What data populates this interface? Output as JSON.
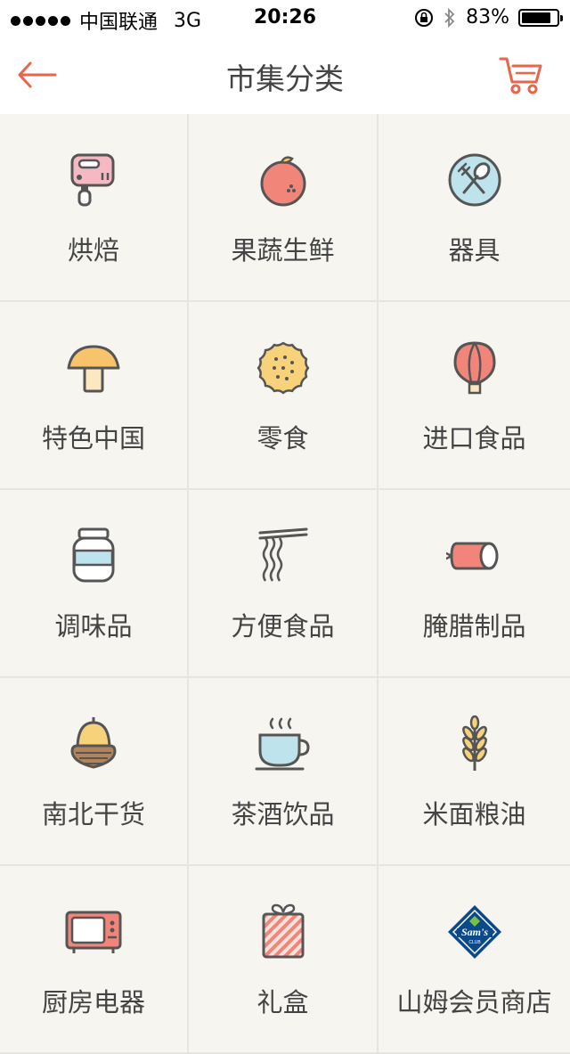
{
  "status": {
    "carrier": "中国联通",
    "network": "3G",
    "time": "20:26",
    "battery": "83%"
  },
  "nav": {
    "title": "市集分类",
    "back_icon": "back-arrow-icon",
    "cart_icon": "cart-icon"
  },
  "colors": {
    "accent": "#e8664a",
    "background": "#f6f5f0",
    "divider": "#e6e5e0"
  },
  "categories": [
    {
      "label": "烘焙",
      "icon": "mixer-icon"
    },
    {
      "label": "果蔬生鲜",
      "icon": "orange-icon"
    },
    {
      "label": "器具",
      "icon": "utensils-icon"
    },
    {
      "label": "特色中国",
      "icon": "mushroom-icon"
    },
    {
      "label": "零食",
      "icon": "cookie-icon"
    },
    {
      "label": "进口食品",
      "icon": "balloon-icon"
    },
    {
      "label": "调味品",
      "icon": "jar-icon"
    },
    {
      "label": "方便食品",
      "icon": "noodles-icon"
    },
    {
      "label": "腌腊制品",
      "icon": "ham-icon"
    },
    {
      "label": "南北干货",
      "icon": "acorn-icon"
    },
    {
      "label": "茶酒饮品",
      "icon": "tea-cup-icon"
    },
    {
      "label": "米面粮油",
      "icon": "wheat-icon"
    },
    {
      "label": "厨房电器",
      "icon": "microwave-icon"
    },
    {
      "label": "礼盒",
      "icon": "gift-box-icon"
    },
    {
      "label": "山姆会员商店",
      "icon": "sams-club-logo"
    }
  ]
}
